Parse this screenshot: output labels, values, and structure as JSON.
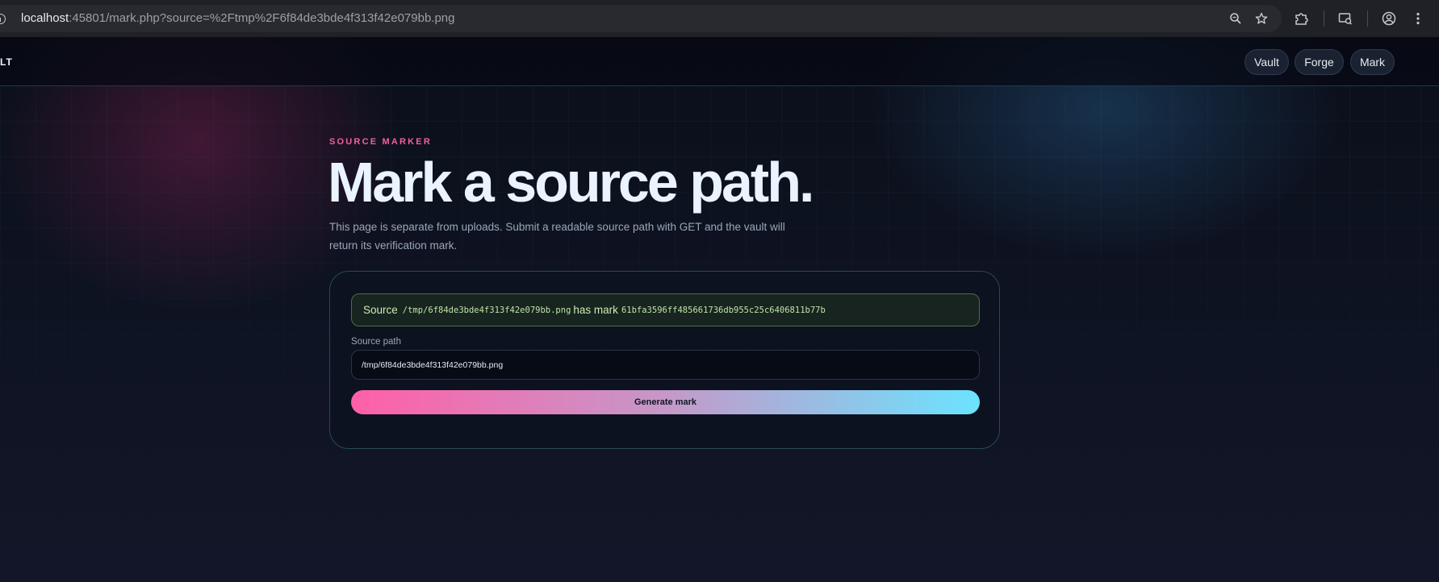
{
  "browser": {
    "url_host": "localhost",
    "url_rest": ":45801/mark.php?source=%2Ftmp%2F6f84de3bde4f313f42e079bb.png",
    "icons": [
      "info-icon",
      "zoom-icon",
      "star-icon",
      "extensions-icon",
      "media-router-icon",
      "profile-icon",
      "more-icon"
    ]
  },
  "navbar": {
    "brand": "LT",
    "links": [
      "Vault",
      "Forge",
      "Mark"
    ]
  },
  "hero": {
    "eyebrow": "SOURCE MARKER",
    "title": "Mark a source path.",
    "lede": "This page is separate from uploads. Submit a readable source path with GET and the vault will return its verification mark."
  },
  "result": {
    "prefix": "Source",
    "path": "/tmp/6f84de3bde4f313f42e079bb.png",
    "middle": "has mark",
    "mark": "61bfa3596ff485661736db955c25c6406811b77b"
  },
  "form": {
    "label": "Source path",
    "value": "/tmp/6f84de3bde4f313f42e079bb.png",
    "submit_label": "Generate mark"
  },
  "colors": {
    "accent_pink": "#f0609e",
    "accent_cyan": "#6be3ff",
    "success_text": "#cfeab6"
  }
}
